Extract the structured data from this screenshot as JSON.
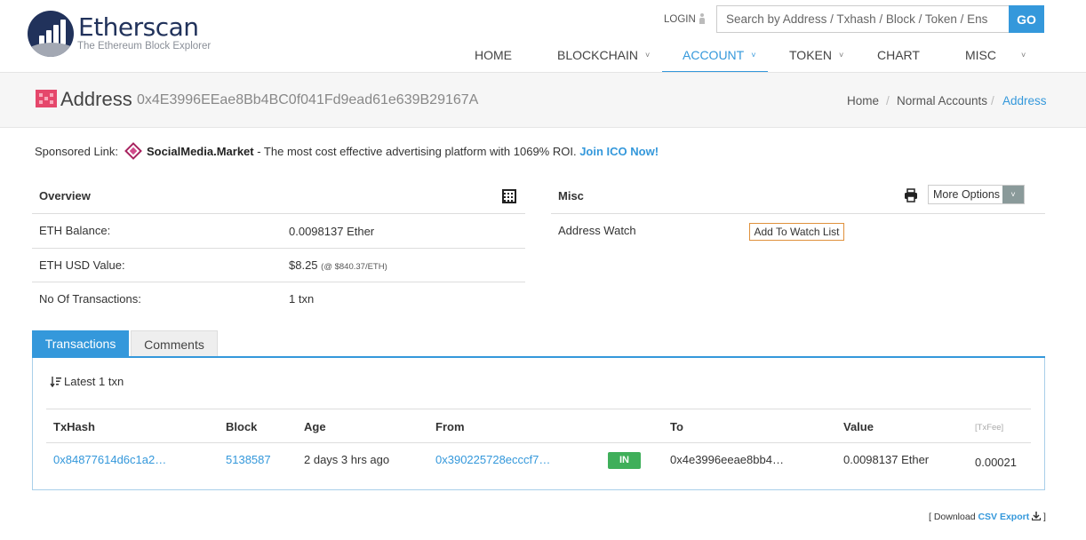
{
  "header": {
    "logo_title": "Etherscan",
    "logo_subtitle": "The Ethereum Block Explorer",
    "login_label": "LOGIN",
    "search_placeholder": "Search by Address / Txhash / Block / Token / Ens",
    "go_label": "GO",
    "nav": [
      {
        "label": "HOME",
        "dropdown": false
      },
      {
        "label": "BLOCKCHAIN",
        "dropdown": true
      },
      {
        "label": "ACCOUNT",
        "dropdown": true,
        "active": true
      },
      {
        "label": "TOKEN",
        "dropdown": true
      },
      {
        "label": "CHART",
        "dropdown": false
      },
      {
        "label": "MISC",
        "dropdown": true
      }
    ],
    "caret": "˅"
  },
  "titlebar": {
    "title": "Address",
    "address": "0x4E3996EEae8Bb4BC0f041Fd9ead61e639B29167A",
    "breadcrumb": [
      "Home",
      "Normal Accounts",
      "Address"
    ],
    "separator": "/"
  },
  "sponsored": {
    "label": "Sponsored Link:",
    "brand": "SocialMedia.Market",
    "text": " - The most cost effective advertising platform with 1069% ROI. ",
    "cta": "Join ICO Now!"
  },
  "overview": {
    "heading": "Overview",
    "rows": [
      {
        "label": "ETH Balance:",
        "value": "0.0098137 Ether",
        "note": ""
      },
      {
        "label": "ETH USD Value:",
        "value": "$8.25",
        "note": "(@ $840.37/ETH)"
      },
      {
        "label": "No Of Transactions:",
        "value": "1 txn",
        "note": ""
      }
    ]
  },
  "misc": {
    "heading": "Misc",
    "more_options": "More Options",
    "watch_label": "Address Watch",
    "watch_button": "Add To Watch List"
  },
  "tabs": [
    {
      "label": "Transactions",
      "active": true
    },
    {
      "label": "Comments",
      "active": false
    }
  ],
  "transactions": {
    "summary": "Latest 1 txn",
    "columns": [
      "TxHash",
      "Block",
      "Age",
      "From",
      "To",
      "Value",
      "[TxFee]"
    ],
    "rows": [
      {
        "txhash": "0x84877614d6c1a2…",
        "block": "5138587",
        "age": "2 days 3 hrs ago",
        "from": "0x390225728ecccf7…",
        "direction": "IN",
        "to": "0x4e3996eeae8bb4…",
        "value": "0.0098137 Ether",
        "fee": "0.00021"
      }
    ]
  },
  "csv": {
    "open": "[ Download ",
    "link": "CSV Export",
    "close": " ]"
  },
  "colors": {
    "accent": "#3498db",
    "in_badge": "#3faf5a",
    "logo": "#21325b"
  }
}
